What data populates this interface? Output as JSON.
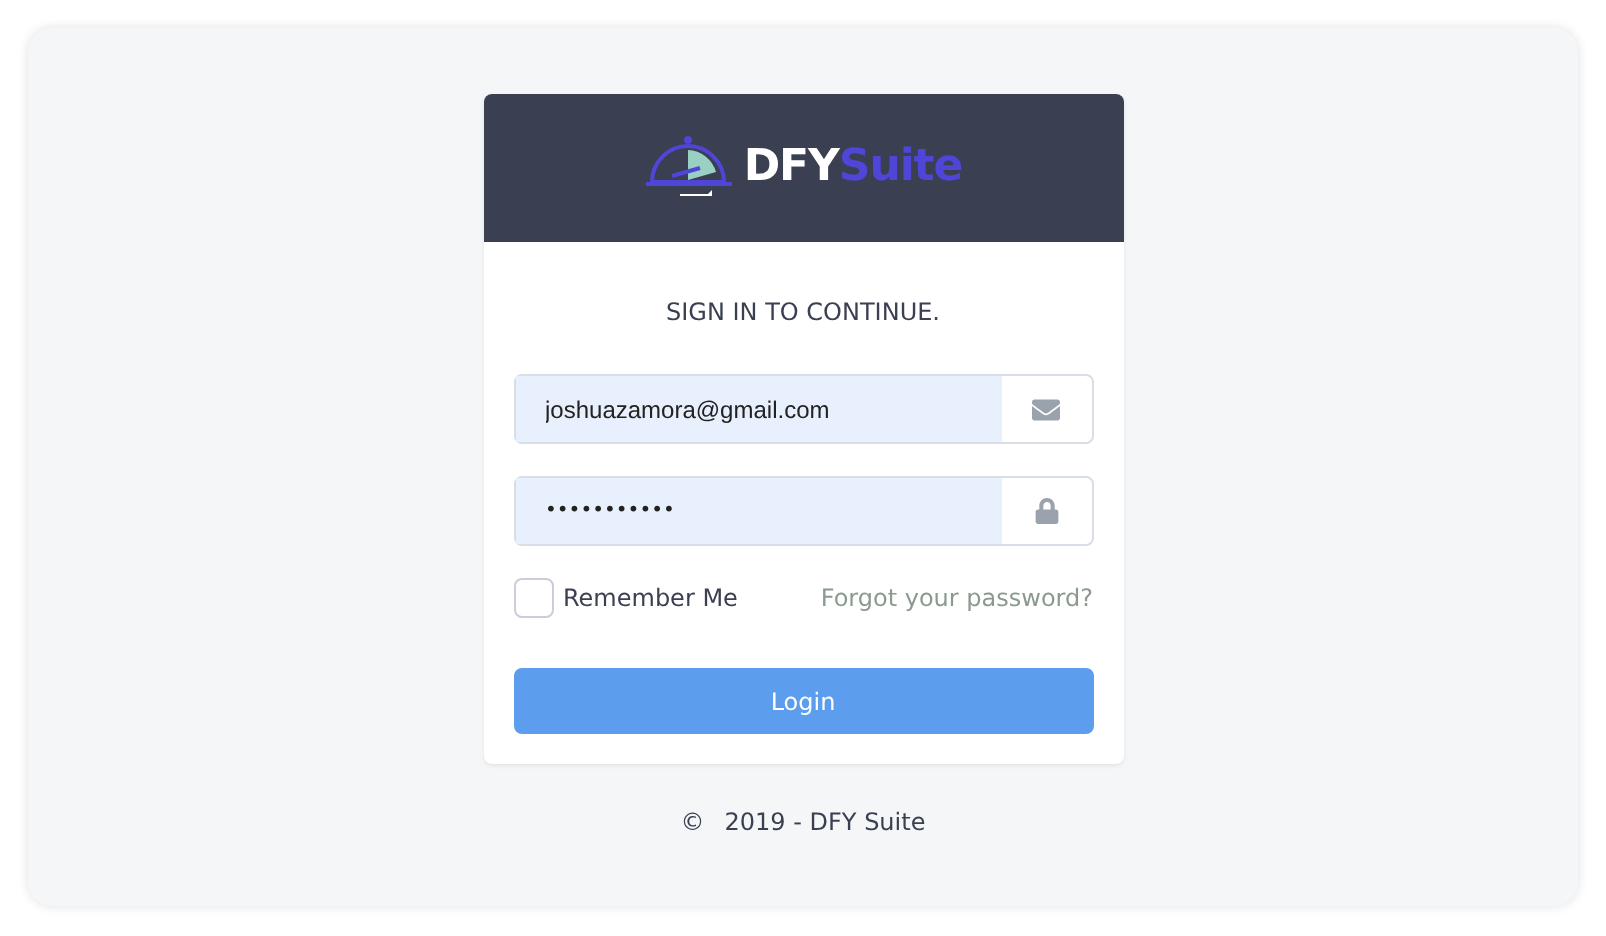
{
  "logo": {
    "part_1": "DFY",
    "part_2": "Suite"
  },
  "heading": "SIGN IN TO CONTINUE.",
  "email_field": {
    "value": "joshuazamora@gmail.com"
  },
  "password_field": {
    "value": "•••••••••••"
  },
  "remember_me": {
    "label": "Remember Me",
    "checked": false
  },
  "forgot_link": "Forgot your password?",
  "login_button": "Login",
  "footer": {
    "copyright": "©",
    "text": "2019 - DFY Suite"
  }
}
